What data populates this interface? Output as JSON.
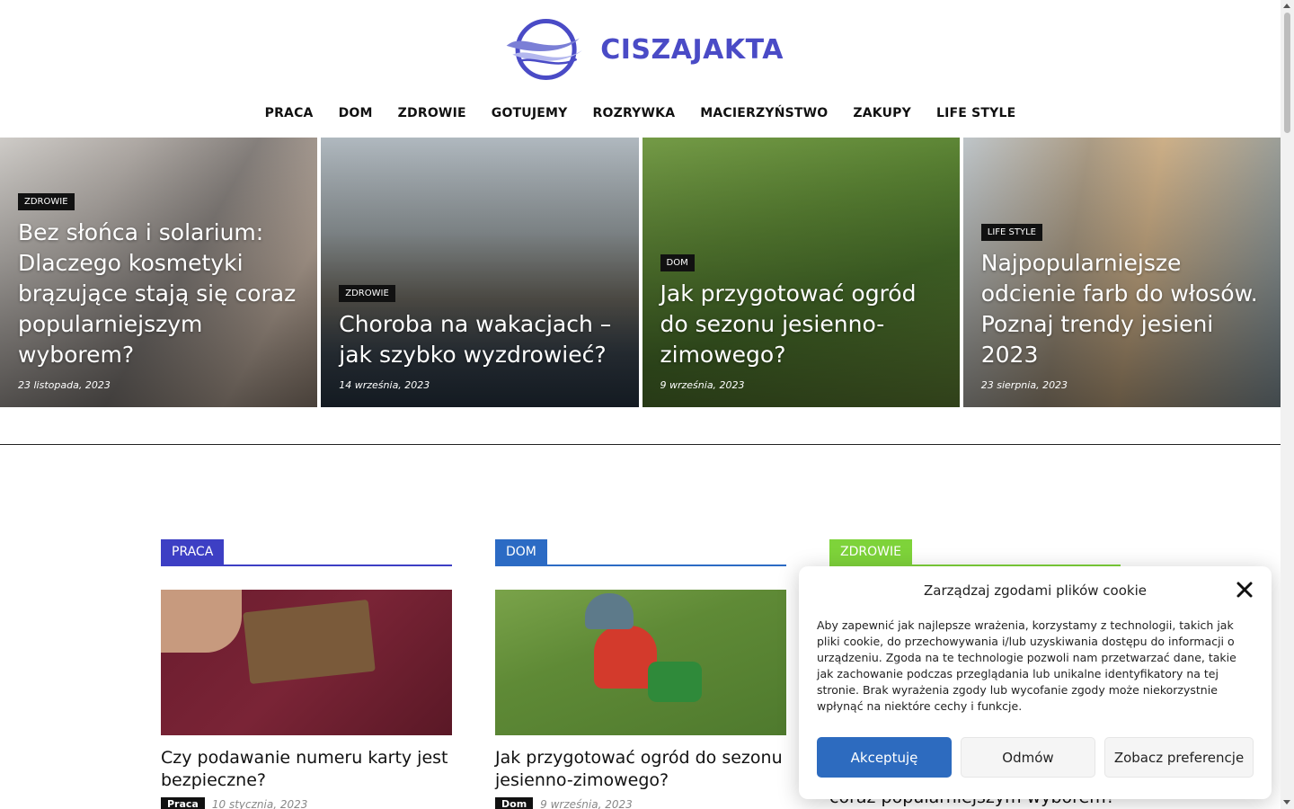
{
  "header": {
    "logo_text": "CISZAJAKTA"
  },
  "nav": [
    "PRACA",
    "DOM",
    "ZDROWIE",
    "GOTUJEMY",
    "ROZRYWKA",
    "MACIERZYŃSTWO",
    "ZAKUPY",
    "LIFE STYLE"
  ],
  "hero": [
    {
      "category": "ZDROWIE",
      "title": "Bez słońca i solarium: Dlaczego kosmetyki brązujące stają się coraz popularniejszym wyborem?",
      "date": "23 listopada, 2023"
    },
    {
      "category": "ZDROWIE",
      "title": "Choroba na wakacjach – jak szybko wyzdrowieć?",
      "date": "14 września, 2023"
    },
    {
      "category": "DOM",
      "title": "Jak przygotować ogród do sezonu jesienno-zimowego?",
      "date": "9 września, 2023"
    },
    {
      "category": "LIFE STYLE",
      "title": "Najpopularniejsze odcienie farb do włosów. Poznaj trendy jesieni 2023",
      "date": "23 sierpnia, 2023"
    }
  ],
  "sections": [
    {
      "label": "PRACA",
      "color": "#3d3fc4",
      "title": "Czy podawanie numeru karty jest bezpieczne?",
      "cat": "Praca",
      "date": "10 stycznia, 2023"
    },
    {
      "label": "DOM",
      "color": "#2c6bc4",
      "title": "Jak przygotować ogród do sezonu jesienno-zimowego?",
      "cat": "Dom",
      "date": "9 września, 2023"
    },
    {
      "label": "ZDROWIE",
      "color": "#7ed33a",
      "peek_title": "coraz popularniejszym wyborem?"
    }
  ],
  "cookie": {
    "title": "Zarządzaj zgodami plików cookie",
    "text": "Aby zapewnić jak najlepsze wrażenia, korzystamy z technologii, takich jak pliki cookie, do przechowywania i/lub uzyskiwania dostępu do informacji o urządzeniu. Zgoda na te technologie pozwoli nam przetwarzać dane, takie jak zachowanie podczas przeglądania lub unikalne identyfikatory na tej stronie. Brak wyrażenia zgody lub wycofanie zgody może niekorzystnie wpłynąć na niektóre cechy i funkcje.",
    "accept": "Akceptuję",
    "deny": "Odmów",
    "prefs": "Zobacz preferencje"
  }
}
